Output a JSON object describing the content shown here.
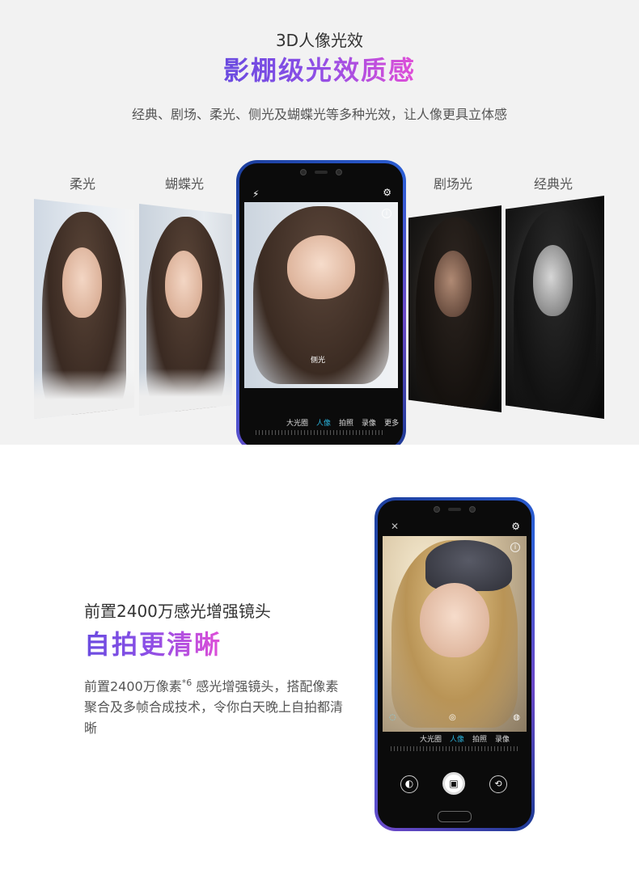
{
  "section1": {
    "subtitle": "3D人像光效",
    "title": "影棚级光效质感",
    "description": "经典、剧场、柔光、侧光及蝴蝶光等多种光效，让人像更具立体感",
    "labels": {
      "soft": "柔光",
      "butterfly": "蝴蝶光",
      "theater": "剧场光",
      "classic": "经典光"
    },
    "phone": {
      "effect_label": "侧光",
      "modes": [
        "大光圈",
        "人像",
        "拍照",
        "录像",
        "更多"
      ],
      "active_mode": "人像"
    }
  },
  "section2": {
    "subtitle": "前置2400万感光增强镜头",
    "title": "自拍更清晰",
    "description_before_sup": "前置2400万像素",
    "description_sup": "*6",
    "description_after_sup": "感光增强镜头，搭配像素聚合及多帧合成技术，令你白天晚上自拍都清晰",
    "phone": {
      "modes": [
        "大光圈",
        "人像",
        "拍照",
        "录像"
      ],
      "active_mode": "人像"
    }
  },
  "colors": {
    "title_gradient_start": "#6a4be0",
    "title_gradient_end": "#e04fd8",
    "accent_mode": "#2ab0d8",
    "phone_body": "#2c5fd6"
  }
}
